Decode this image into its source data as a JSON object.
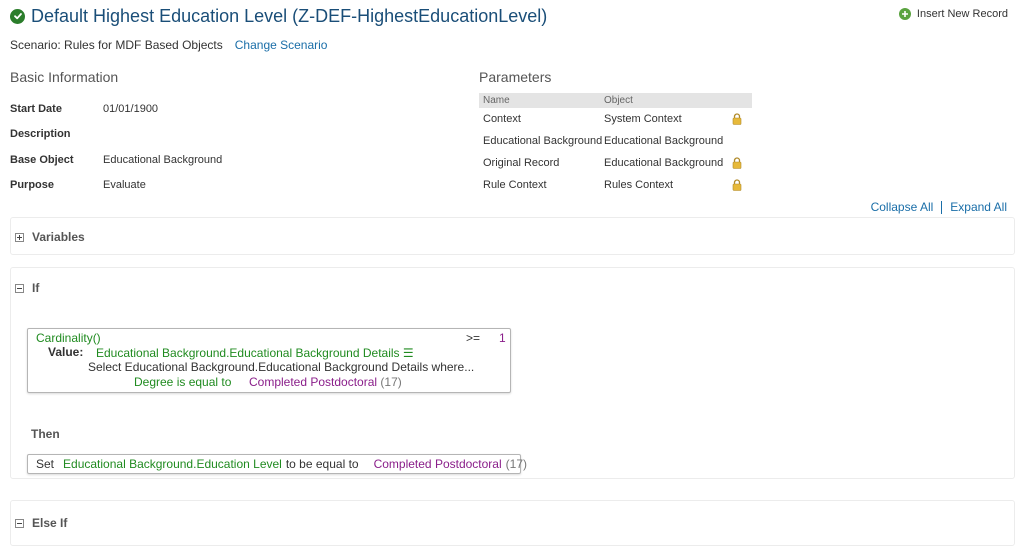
{
  "header": {
    "title": "Default Highest Education Level (Z-DEF-HighestEducationLevel)",
    "insert_label": "Insert New Record"
  },
  "scenario": {
    "label": "Scenario: Rules for MDF Based Objects",
    "change_label": "Change Scenario"
  },
  "basic_info": {
    "title": "Basic Information",
    "rows": [
      {
        "label": "Start Date",
        "value": "01/01/1900"
      },
      {
        "label": "Description",
        "value": ""
      },
      {
        "label": "Base Object",
        "value": "Educational Background"
      },
      {
        "label": "Purpose",
        "value": "Evaluate"
      }
    ]
  },
  "parameters": {
    "title": "Parameters",
    "col_name": "Name",
    "col_object": "Object",
    "rows": [
      {
        "name": "Context",
        "object": "System Context",
        "locked": true
      },
      {
        "name": "Educational Background",
        "object": "Educational Background",
        "locked": false
      },
      {
        "name": "Original Record",
        "object": "Educational Background",
        "locked": true
      },
      {
        "name": "Rule Context",
        "object": "Rules Context",
        "locked": true
      }
    ]
  },
  "toolbar": {
    "collapse_all": "Collapse All",
    "expand_all": "Expand All"
  },
  "variables": {
    "title": "Variables"
  },
  "if_block": {
    "title": "If",
    "function": "Cardinality()",
    "operator": ">=",
    "compare_value": "1",
    "value_label": "Value:",
    "value_field": "Educational Background.Educational Background Details ☰",
    "select_text": "Select Educational Background.Educational Background Details where...",
    "filter_field": "Degree is equal to",
    "filter_value": "Completed Postdoctoral",
    "filter_code": "(17)"
  },
  "then_block": {
    "title": "Then",
    "set_label": "Set",
    "field": "Educational Background.Education Level",
    "mid_text": "to be equal to",
    "value": "Completed Postdoctoral",
    "code": "(17)"
  },
  "else_if": {
    "title": "Else If"
  },
  "colors": {
    "title_blue": "#1a4e78",
    "link_blue": "#1a6ea8",
    "field_green": "#208b20",
    "value_purple": "#8a1e8a",
    "success_green": "#2b7d2b"
  }
}
